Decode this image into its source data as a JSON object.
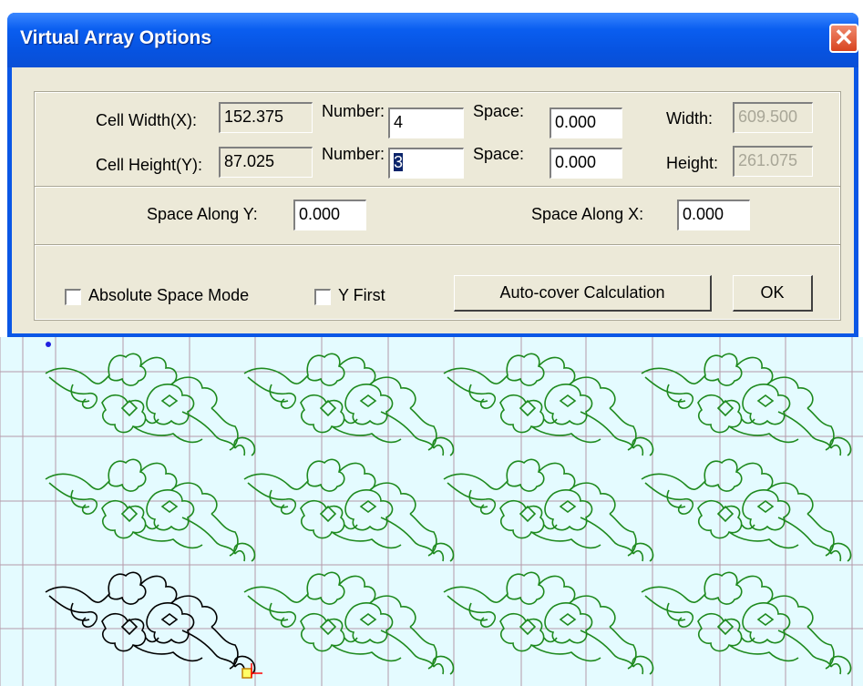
{
  "dialog": {
    "title": "Virtual Array Options",
    "close_glyph": "✕",
    "fields": {
      "cell_width_label": "Cell Width(X):",
      "cell_width_value": "152.375",
      "cell_height_label": "Cell Height(Y):",
      "cell_height_value": "87.025",
      "number_x_label": "Number:",
      "number_x_value": "4",
      "number_y_label": "Number:",
      "number_y_value": "3",
      "space_x_label": "Space:",
      "space_x_value": "0.000",
      "space_y_label": "Space:",
      "space_y_value": "0.000",
      "width_label": "Width:",
      "width_value": "609.500",
      "height_label": "Height:",
      "height_value": "261.075",
      "space_along_y_label": "Space Along Y:",
      "space_along_y_value": "0.000",
      "space_along_x_label": "Space Along X:",
      "space_along_x_value": "0.000"
    },
    "options": {
      "absolute_space_mode_label": "Absolute Space Mode",
      "absolute_space_mode_checked": false,
      "y_first_label": "Y First",
      "y_first_checked": false
    },
    "buttons": {
      "auto_cover_label": "Auto-cover Calculation",
      "ok_label": "OK"
    }
  },
  "canvas": {
    "background_color": "#e4fbff",
    "grid_color": "#b59aa8",
    "pattern_color_array": "#1e8a1e",
    "pattern_color_selected": "#000000",
    "array_columns": 4,
    "array_rows": 3
  }
}
